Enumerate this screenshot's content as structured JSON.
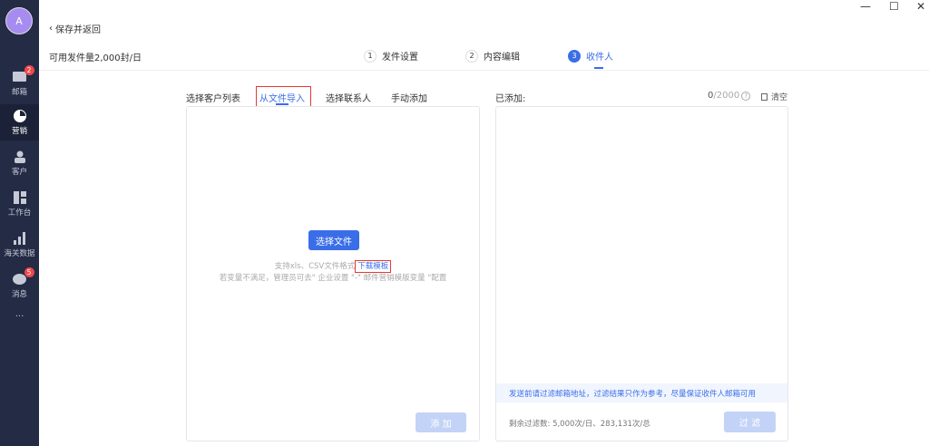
{
  "sidebar": {
    "avatar": "A",
    "items": [
      {
        "label": "邮箱",
        "icon": "mail-icon",
        "badge": "2"
      },
      {
        "label": "营销",
        "icon": "pie-chart-icon",
        "active": true
      },
      {
        "label": "客户",
        "icon": "user-icon"
      },
      {
        "label": "工作台",
        "icon": "dashboard-icon"
      },
      {
        "label": "海关数据",
        "icon": "bar-chart-icon"
      },
      {
        "label": "消息",
        "icon": "chat-icon",
        "badge": "5"
      }
    ],
    "more": "···"
  },
  "window": {
    "minimize": "—",
    "maximize": "☐",
    "close": "✕"
  },
  "header": {
    "back": "保存并返回",
    "quota": "可用发件量2,000封/日"
  },
  "steps": [
    {
      "num": "1",
      "label": "发件设置"
    },
    {
      "num": "2",
      "label": "内容编辑"
    },
    {
      "num": "3",
      "label": "收件人",
      "active": true
    }
  ],
  "tabs": [
    "选择客户列表",
    "从文件导入",
    "选择联系人",
    "手动添加"
  ],
  "import": {
    "choose_file": "选择文件",
    "support": "支持xls、CSV文件格式",
    "download": "下载模板",
    "hint": "若变量不满足，管理员可去\" 企业设置 \"-\" 邮件营销模版变量 \"配置",
    "add": "添 加"
  },
  "added": {
    "label": "已添加:",
    "count": "0",
    "max": "/2000",
    "help": "?",
    "clear": "清空",
    "notice": "发送前请过滤邮箱地址，过滤结果只作为参考，尽量保证收件人邮箱可用",
    "remaining": "剩余过滤数: 5,000次/日、283,131次/总",
    "filter": "过 滤"
  },
  "colors": {
    "accent": "#3a6ee8",
    "sidebar": "#232b45",
    "disabled": "#c3d3f7",
    "highlight": "#e53935"
  }
}
